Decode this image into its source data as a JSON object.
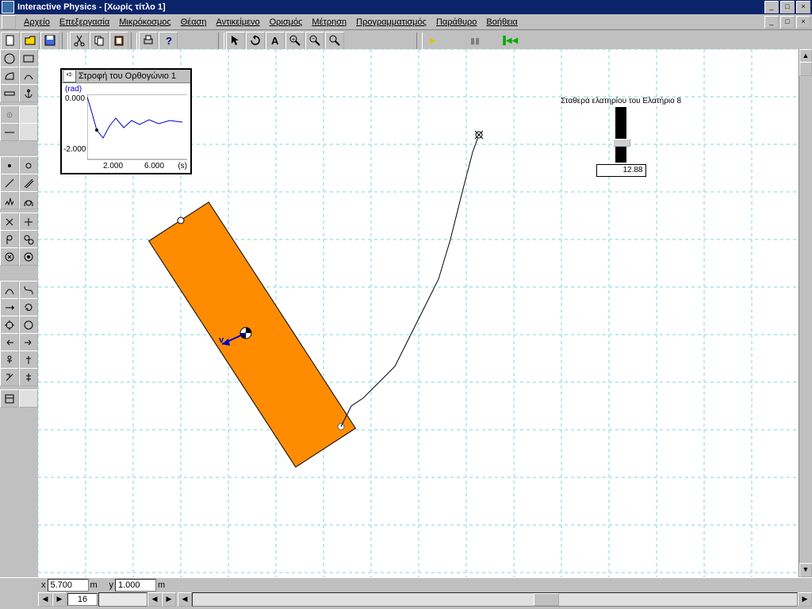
{
  "app_title": "Interactive Physics - [Χωρίς τίτλο 1]",
  "menus": {
    "m0": "Αρχείο",
    "m1": "Επεξεργασία",
    "m2": "Μικρόκοσμος",
    "m3": "Θέαση",
    "m4": "Αντικείμενο",
    "m5": "Ορισμός",
    "m6": "Μέτρηση",
    "m7": "Προγραμματισμός",
    "m8": "Παράθυρο",
    "m9": "Βοήθεια"
  },
  "playback": {
    "run": "►",
    "pause": "▮▮",
    "reset": "▐◀◀"
  },
  "plot": {
    "title": "Στροφή του Ορθογώνιο 1",
    "unit": "(rad)",
    "y0": "0.000",
    "y1": "-2.000",
    "x0": "2.000",
    "x1": "6.000",
    "xunit": "(s)"
  },
  "slider": {
    "title": "Σταθερά ελατηρίου του Ελατήριο 8",
    "value": "12.88"
  },
  "coords": {
    "xlab": "x",
    "xval": "5.700",
    "xunit": "m",
    "ylab": "y",
    "yval": "1.000",
    "yunit": "m"
  },
  "frame": "16",
  "vector_label": "v"
}
